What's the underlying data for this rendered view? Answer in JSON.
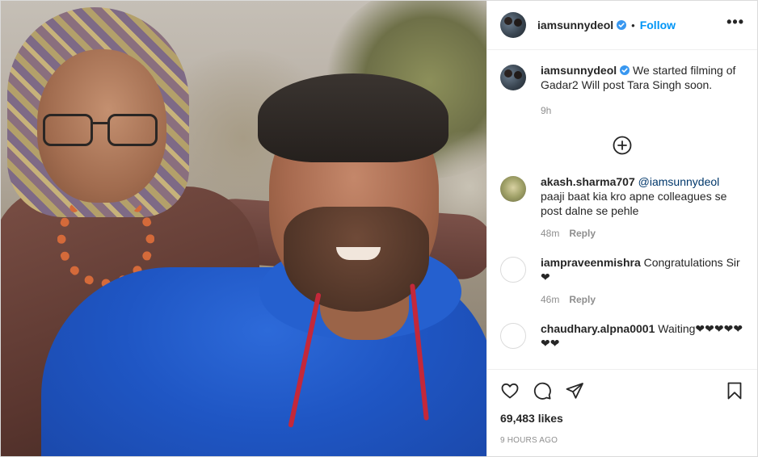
{
  "post": {
    "author": {
      "username": "iamsunnydeol",
      "verified": true,
      "follow_label": "Follow",
      "more_label": "•••"
    },
    "caption": {
      "username": "iamsunnydeol",
      "text": "We started filming of Gadar2 Will post Tara Singh soon.",
      "time": "9h"
    },
    "load_more_icon": "plus-circle-icon",
    "comments": [
      {
        "username": "akash.sharma707",
        "mention": "@iamsunnydeol",
        "text": "paaji baat kia kro apne colleagues se post dalne se pehle",
        "time": "48m",
        "reply_label": "Reply"
      },
      {
        "username": "iampraveenmishra",
        "text": "Congratulations Sir❤",
        "time": "46m",
        "reply_label": "Reply"
      },
      {
        "username": "chaudhary.alpna0001",
        "text": "Waiting❤❤❤❤❤❤❤"
      }
    ],
    "actions": {
      "like_icon": "heart-icon",
      "comment_icon": "comment-icon",
      "share_icon": "share-icon",
      "save_icon": "bookmark-icon"
    },
    "likes_text": "69,483 likes",
    "posted_ago": "9 HOURS AGO"
  },
  "colors": {
    "accent": "#0095f6",
    "verified_badge": "#3897f0",
    "muted_text": "#8e8e8e",
    "border": "#dbdbdb"
  }
}
